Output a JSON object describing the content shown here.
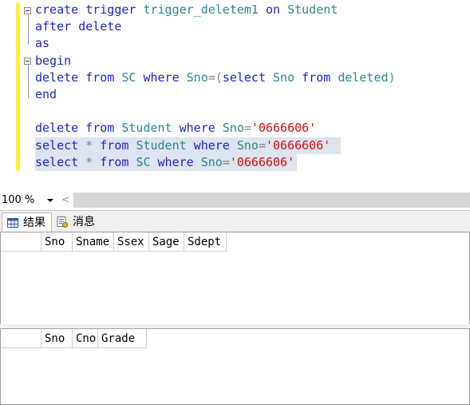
{
  "editor": {
    "lines": [
      [
        {
          "t": "create trigger ",
          "c": "kw"
        },
        {
          "t": "trigger_deletem1 ",
          "c": "id"
        },
        {
          "t": "on ",
          "c": "kw"
        },
        {
          "t": "Student",
          "c": "id"
        }
      ],
      [
        {
          "t": "after ",
          "c": "kw"
        },
        {
          "t": "delete",
          "c": "kw"
        }
      ],
      [
        {
          "t": "as",
          "c": "kw"
        }
      ],
      [
        {
          "t": "begin",
          "c": "kw"
        }
      ],
      [
        {
          "t": "delete ",
          "c": "kw"
        },
        {
          "t": "from ",
          "c": "kw"
        },
        {
          "t": "SC ",
          "c": "id"
        },
        {
          "t": "where ",
          "c": "kw"
        },
        {
          "t": "Sno",
          "c": "id"
        },
        {
          "t": "=(",
          "c": "gr"
        },
        {
          "t": "select ",
          "c": "kw"
        },
        {
          "t": "Sno ",
          "c": "id"
        },
        {
          "t": "from ",
          "c": "kw"
        },
        {
          "t": "deleted",
          "c": "id"
        },
        {
          "t": ")",
          "c": "gr"
        }
      ],
      [
        {
          "t": "end",
          "c": "kw"
        }
      ],
      [],
      [
        {
          "t": "delete ",
          "c": "kw"
        },
        {
          "t": "from ",
          "c": "kw"
        },
        {
          "t": "Student ",
          "c": "id"
        },
        {
          "t": "where ",
          "c": "kw"
        },
        {
          "t": "Sno",
          "c": "id"
        },
        {
          "t": "=",
          "c": "gr"
        },
        {
          "t": "'0666606'",
          "c": "str"
        }
      ],
      [
        {
          "t": "select ",
          "c": "kw"
        },
        {
          "t": "* ",
          "c": "gr"
        },
        {
          "t": "from ",
          "c": "kw"
        },
        {
          "t": "Student ",
          "c": "id"
        },
        {
          "t": "where ",
          "c": "kw"
        },
        {
          "t": "Sno",
          "c": "id"
        },
        {
          "t": "=",
          "c": "gr"
        },
        {
          "t": "'0666606'",
          "c": "str"
        }
      ],
      [
        {
          "t": "select ",
          "c": "kw"
        },
        {
          "t": "* ",
          "c": "gr"
        },
        {
          "t": "from ",
          "c": "kw"
        },
        {
          "t": "SC ",
          "c": "id"
        },
        {
          "t": "where ",
          "c": "kw"
        },
        {
          "t": "Sno",
          "c": "id"
        },
        {
          "t": "=",
          "c": "gr"
        },
        {
          "t": "'0666606'",
          "c": "str"
        }
      ]
    ],
    "selected_lines": [
      8,
      9
    ]
  },
  "zoom": {
    "value": "100 %",
    "scroll_left_glyph": "<"
  },
  "result_tabs": [
    {
      "label": "结果",
      "icon": "grid-icon",
      "active": true
    },
    {
      "label": "消息",
      "icon": "messages-icon",
      "active": false
    }
  ],
  "grids": [
    {
      "columns": [
        "Sno",
        "Sname",
        "Ssex",
        "Sage",
        "Sdept"
      ],
      "rows": []
    },
    {
      "columns": [
        "Sno",
        "Cno",
        "Grade"
      ],
      "rows": []
    }
  ],
  "colors": {
    "keyword": "#1e24c8",
    "identifier": "#2a8a8a",
    "string": "#d2120e",
    "operator": "#7f7f7f",
    "change_bar": "#ffef3a",
    "selection": "#dde3ef"
  }
}
